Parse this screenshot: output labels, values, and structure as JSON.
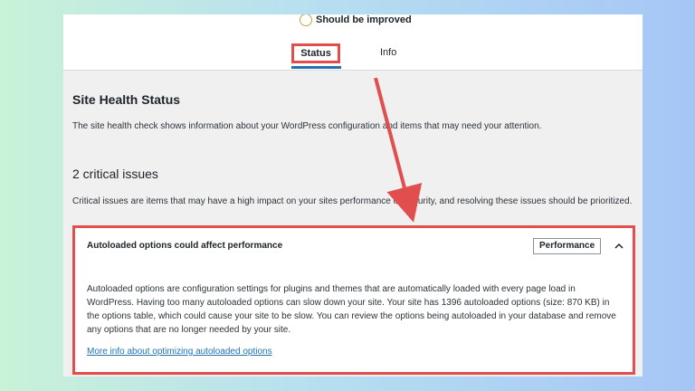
{
  "site_health": {
    "score_label": "Should be improved",
    "tabs": {
      "status": "Status",
      "info": "Info"
    },
    "title": "Site Health Status",
    "description": "The site health check shows information about your WordPress configuration and items that may need your attention.",
    "issues_heading": "2 critical issues",
    "issues_description": "Critical issues are items that may have a high impact on your sites performance or security, and resolving these issues should be prioritized.",
    "issue": {
      "title": "Autoloaded options could affect performance",
      "badge": "Performance",
      "body": "Autoloaded options are configuration settings for plugins and themes that are automatically loaded with every page load in WordPress. Having too many autoloaded options can slow down your site. Your site has 1396 autoloaded options (size: 870 KB) in the options table, which could cause your site to be slow. You can review the options being autoloaded in your database and remove any options that are no longer needed by your site.",
      "link": "More info about optimizing autoloaded options",
      "expanded_icon": "chevron-up-icon"
    }
  },
  "colors": {
    "highlight": "#e14e4e",
    "link": "#2271b1",
    "score": "#c9a24b"
  }
}
